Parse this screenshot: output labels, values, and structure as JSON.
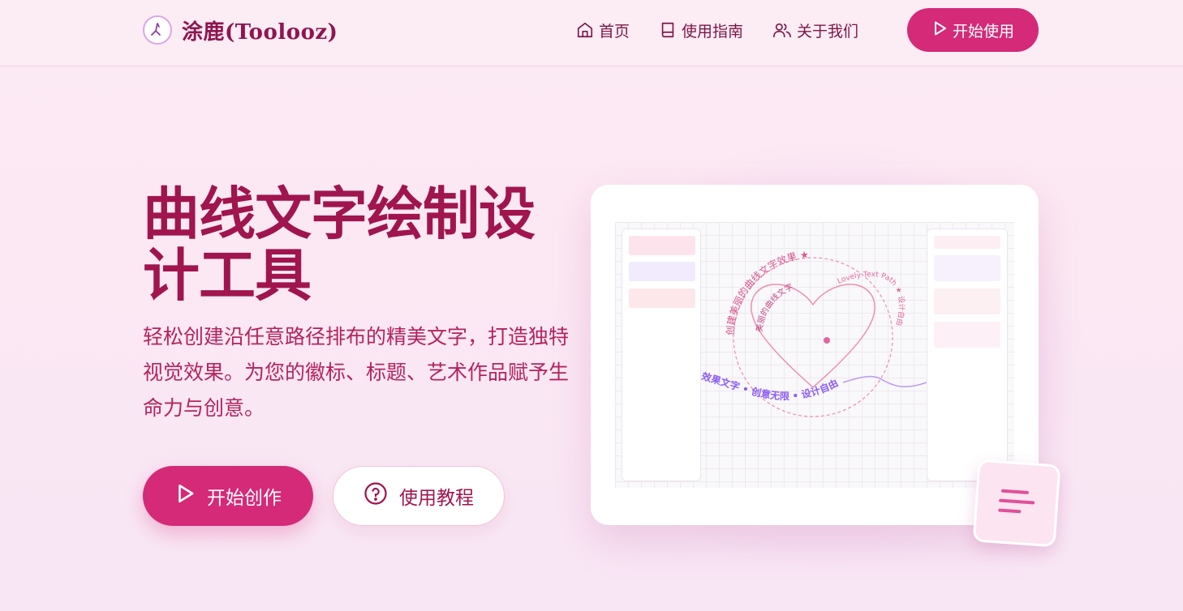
{
  "header": {
    "brand": "涂鹿(Toolooz)",
    "nav": [
      {
        "label": "首页",
        "icon": "home-icon"
      },
      {
        "label": "使用指南",
        "icon": "book-icon"
      },
      {
        "label": "关于我们",
        "icon": "users-icon"
      }
    ],
    "cta_label": "开始使用"
  },
  "hero": {
    "title": "曲线文字绘制设计工具",
    "subtitle": "轻松创建沿任意路径排布的精美文字，打造独特视觉效果。为您的徽标、标题、艺术作品赋予生命力与创意。",
    "primary_label": "开始创作",
    "secondary_label": "使用教程"
  },
  "preview": {
    "circle_text": "创建美丽的曲线文字效果 ★",
    "heart_text": "Lovely Text Path ★ 设计自由",
    "wave_text": "效果文字 • 创意无限 • 设计自由",
    "inner_text": "美丽的曲线文字"
  },
  "colors": {
    "brand": "#d42a78",
    "title": "#a0154e",
    "accent_purple": "#8b5cf6"
  }
}
